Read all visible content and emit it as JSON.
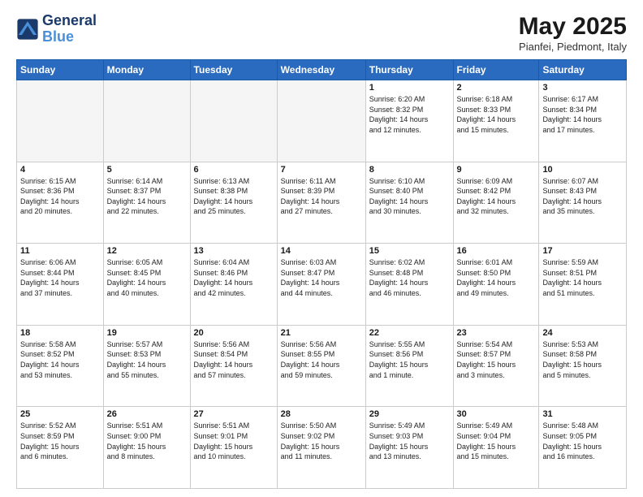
{
  "header": {
    "logo_line1": "General",
    "logo_line2": "Blue",
    "month": "May 2025",
    "location": "Pianfei, Piedmont, Italy"
  },
  "weekdays": [
    "Sunday",
    "Monday",
    "Tuesday",
    "Wednesday",
    "Thursday",
    "Friday",
    "Saturday"
  ],
  "weeks": [
    [
      {
        "num": "",
        "info": ""
      },
      {
        "num": "",
        "info": ""
      },
      {
        "num": "",
        "info": ""
      },
      {
        "num": "",
        "info": ""
      },
      {
        "num": "1",
        "info": "Sunrise: 6:20 AM\nSunset: 8:32 PM\nDaylight: 14 hours\nand 12 minutes."
      },
      {
        "num": "2",
        "info": "Sunrise: 6:18 AM\nSunset: 8:33 PM\nDaylight: 14 hours\nand 15 minutes."
      },
      {
        "num": "3",
        "info": "Sunrise: 6:17 AM\nSunset: 8:34 PM\nDaylight: 14 hours\nand 17 minutes."
      }
    ],
    [
      {
        "num": "4",
        "info": "Sunrise: 6:15 AM\nSunset: 8:36 PM\nDaylight: 14 hours\nand 20 minutes."
      },
      {
        "num": "5",
        "info": "Sunrise: 6:14 AM\nSunset: 8:37 PM\nDaylight: 14 hours\nand 22 minutes."
      },
      {
        "num": "6",
        "info": "Sunrise: 6:13 AM\nSunset: 8:38 PM\nDaylight: 14 hours\nand 25 minutes."
      },
      {
        "num": "7",
        "info": "Sunrise: 6:11 AM\nSunset: 8:39 PM\nDaylight: 14 hours\nand 27 minutes."
      },
      {
        "num": "8",
        "info": "Sunrise: 6:10 AM\nSunset: 8:40 PM\nDaylight: 14 hours\nand 30 minutes."
      },
      {
        "num": "9",
        "info": "Sunrise: 6:09 AM\nSunset: 8:42 PM\nDaylight: 14 hours\nand 32 minutes."
      },
      {
        "num": "10",
        "info": "Sunrise: 6:07 AM\nSunset: 8:43 PM\nDaylight: 14 hours\nand 35 minutes."
      }
    ],
    [
      {
        "num": "11",
        "info": "Sunrise: 6:06 AM\nSunset: 8:44 PM\nDaylight: 14 hours\nand 37 minutes."
      },
      {
        "num": "12",
        "info": "Sunrise: 6:05 AM\nSunset: 8:45 PM\nDaylight: 14 hours\nand 40 minutes."
      },
      {
        "num": "13",
        "info": "Sunrise: 6:04 AM\nSunset: 8:46 PM\nDaylight: 14 hours\nand 42 minutes."
      },
      {
        "num": "14",
        "info": "Sunrise: 6:03 AM\nSunset: 8:47 PM\nDaylight: 14 hours\nand 44 minutes."
      },
      {
        "num": "15",
        "info": "Sunrise: 6:02 AM\nSunset: 8:48 PM\nDaylight: 14 hours\nand 46 minutes."
      },
      {
        "num": "16",
        "info": "Sunrise: 6:01 AM\nSunset: 8:50 PM\nDaylight: 14 hours\nand 49 minutes."
      },
      {
        "num": "17",
        "info": "Sunrise: 5:59 AM\nSunset: 8:51 PM\nDaylight: 14 hours\nand 51 minutes."
      }
    ],
    [
      {
        "num": "18",
        "info": "Sunrise: 5:58 AM\nSunset: 8:52 PM\nDaylight: 14 hours\nand 53 minutes."
      },
      {
        "num": "19",
        "info": "Sunrise: 5:57 AM\nSunset: 8:53 PM\nDaylight: 14 hours\nand 55 minutes."
      },
      {
        "num": "20",
        "info": "Sunrise: 5:56 AM\nSunset: 8:54 PM\nDaylight: 14 hours\nand 57 minutes."
      },
      {
        "num": "21",
        "info": "Sunrise: 5:56 AM\nSunset: 8:55 PM\nDaylight: 14 hours\nand 59 minutes."
      },
      {
        "num": "22",
        "info": "Sunrise: 5:55 AM\nSunset: 8:56 PM\nDaylight: 15 hours\nand 1 minute."
      },
      {
        "num": "23",
        "info": "Sunrise: 5:54 AM\nSunset: 8:57 PM\nDaylight: 15 hours\nand 3 minutes."
      },
      {
        "num": "24",
        "info": "Sunrise: 5:53 AM\nSunset: 8:58 PM\nDaylight: 15 hours\nand 5 minutes."
      }
    ],
    [
      {
        "num": "25",
        "info": "Sunrise: 5:52 AM\nSunset: 8:59 PM\nDaylight: 15 hours\nand 6 minutes."
      },
      {
        "num": "26",
        "info": "Sunrise: 5:51 AM\nSunset: 9:00 PM\nDaylight: 15 hours\nand 8 minutes."
      },
      {
        "num": "27",
        "info": "Sunrise: 5:51 AM\nSunset: 9:01 PM\nDaylight: 15 hours\nand 10 minutes."
      },
      {
        "num": "28",
        "info": "Sunrise: 5:50 AM\nSunset: 9:02 PM\nDaylight: 15 hours\nand 11 minutes."
      },
      {
        "num": "29",
        "info": "Sunrise: 5:49 AM\nSunset: 9:03 PM\nDaylight: 15 hours\nand 13 minutes."
      },
      {
        "num": "30",
        "info": "Sunrise: 5:49 AM\nSunset: 9:04 PM\nDaylight: 15 hours\nand 15 minutes."
      },
      {
        "num": "31",
        "info": "Sunrise: 5:48 AM\nSunset: 9:05 PM\nDaylight: 15 hours\nand 16 minutes."
      }
    ]
  ]
}
